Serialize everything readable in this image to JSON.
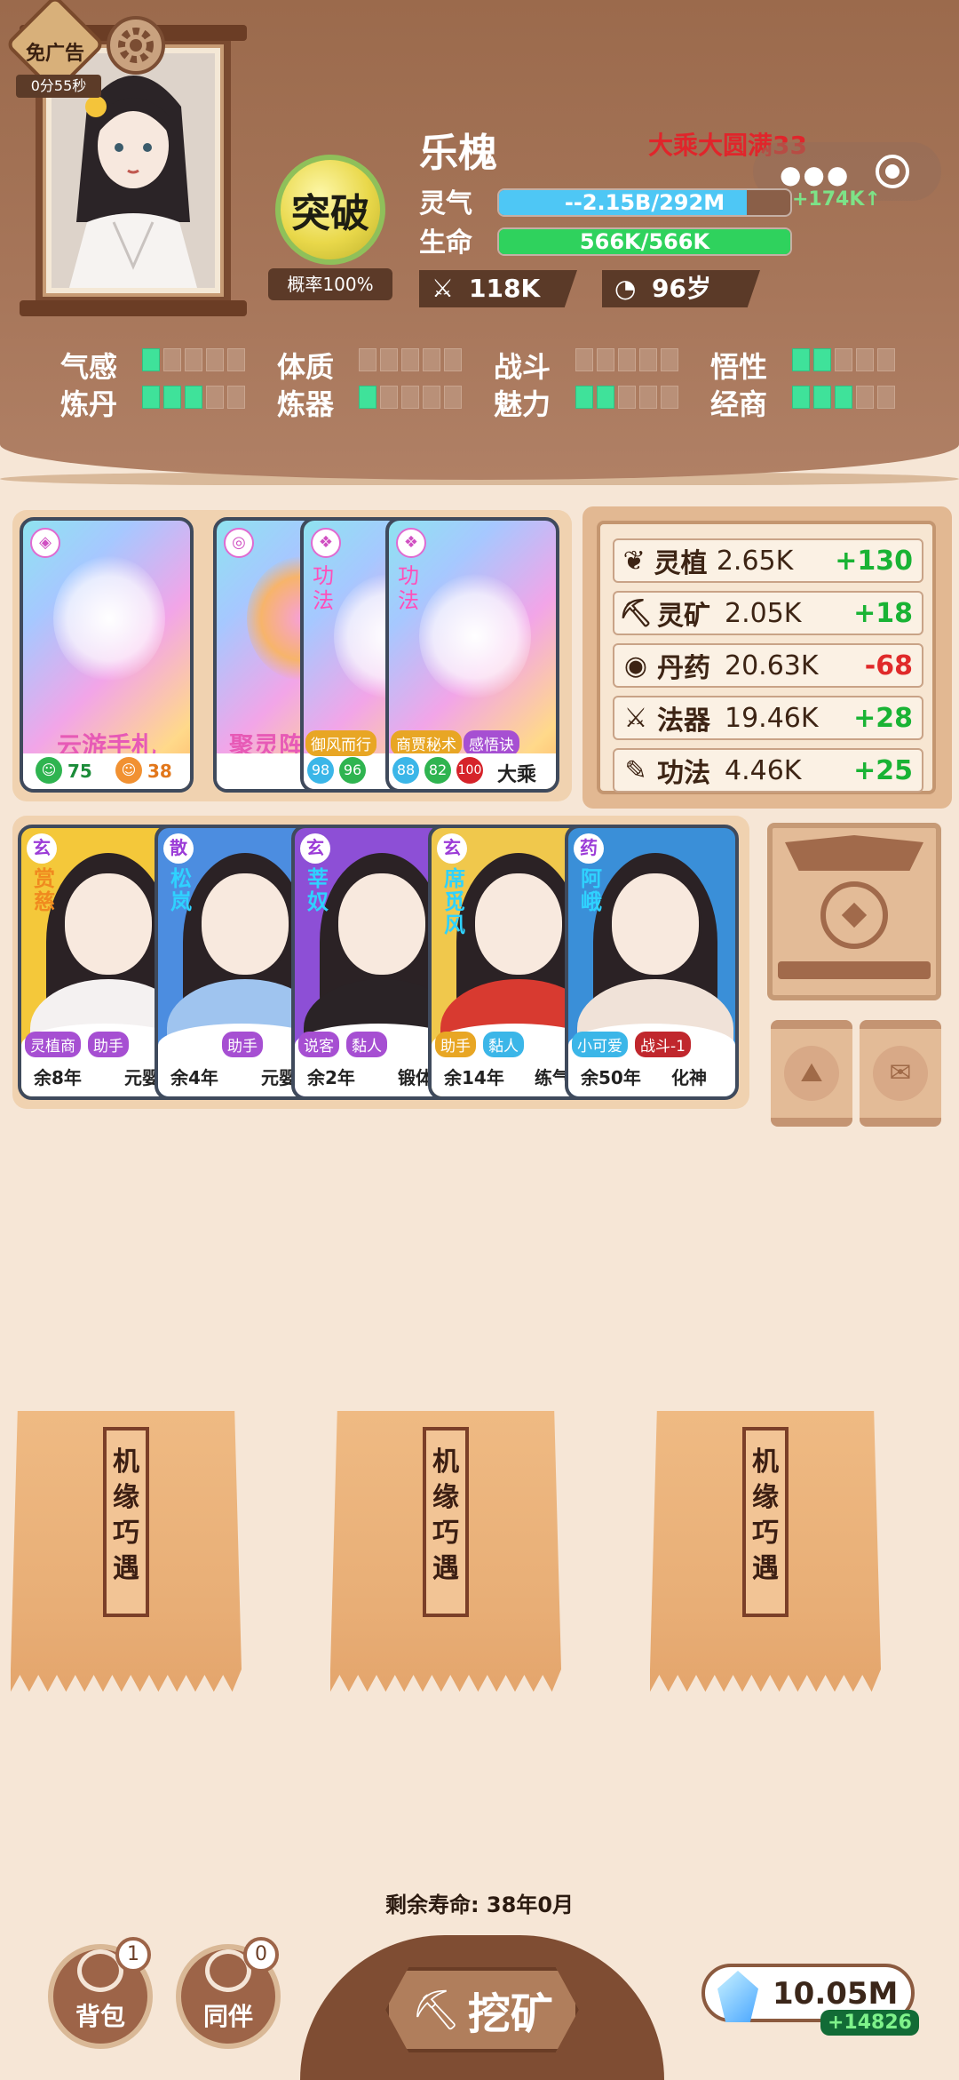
{
  "header": {
    "no_ad_label": "免广告",
    "no_ad_timer": "0分55秒",
    "character_name": "乐槐",
    "realm": "大乘大圆满33",
    "breakthrough_label": "突破",
    "breakthrough_chance": "概率100%",
    "qi_label": "灵气",
    "qi_value": "--2.15B/292M",
    "qi_fill": 0.85,
    "qi_gain": "+174K↑",
    "life_label": "生命",
    "life_value": "566K/566K",
    "life_fill": 1.0,
    "power": "118K",
    "age": "96岁",
    "attributes": [
      {
        "label": "气感",
        "level": 1
      },
      {
        "label": "体质",
        "level": 0
      },
      {
        "label": "战斗",
        "level": 0
      },
      {
        "label": "悟性",
        "level": 2
      },
      {
        "label": "炼丹",
        "level": 3
      },
      {
        "label": "炼器",
        "level": 1
      },
      {
        "label": "魅力",
        "level": 2
      },
      {
        "label": "经商",
        "level": 3
      }
    ]
  },
  "cards": [
    {
      "name": "云游手札",
      "stat1": "75",
      "stat2": "38"
    },
    {
      "name": "聚灵阵"
    },
    {
      "type": "功法",
      "tag": "御风而行",
      "n1": "98",
      "n2": "96"
    },
    {
      "type": "功法",
      "tag1": "商贾秘术",
      "tag2": "感悟诀",
      "n1": "88",
      "n2": "82",
      "n3": "100",
      "realm": "大乘"
    }
  ],
  "resources": [
    {
      "icon": "sprout-icon",
      "label": "灵植",
      "value": "2.65K",
      "delta": "+130"
    },
    {
      "icon": "pickaxe-icon",
      "label": "灵矿",
      "value": "2.05K",
      "delta": "+18"
    },
    {
      "icon": "pill-icon",
      "label": "丹药",
      "value": "20.63K",
      "delta": "-68"
    },
    {
      "icon": "swords-icon",
      "label": "法器",
      "value": "19.46K",
      "delta": "+28"
    },
    {
      "icon": "scroll-icon",
      "label": "功法",
      "value": "4.46K",
      "delta": "+25"
    }
  ],
  "companions": [
    {
      "sect": "玄",
      "name": "赏慈",
      "tag1": "灵植商",
      "tag2": "助手",
      "life": "余8年",
      "job": "元婴",
      "bg": "#f4c83a",
      "robe": "#f4f1f1"
    },
    {
      "sect": "散",
      "name": "松岚",
      "tag1": "",
      "tag2": "助手",
      "life": "余4年",
      "job": "元婴",
      "bg": "#4c8de0",
      "robe": "#9fc4ef"
    },
    {
      "sect": "玄",
      "name": "莘奴",
      "tag1": "说客",
      "tag2": "黏人",
      "life": "余2年",
      "job": "锻体",
      "bg": "#8d4fd6",
      "robe": "#2a2326"
    },
    {
      "sect": "玄",
      "name": "席觅风",
      "tag1": "助手",
      "tag2": "黏人",
      "life": "余14年",
      "job": "练气",
      "bg": "#f0c84c",
      "robe": "#d83a30"
    },
    {
      "sect": "药",
      "name": "阿峨",
      "tag1": "小可爱",
      "tag2": "战斗-1",
      "life": "余50年",
      "job": "化神",
      "bg": "#3a8fd8",
      "robe": "#f0e2d8"
    }
  ],
  "fortune_bag_text": [
    "机",
    "缘",
    "巧",
    "遇"
  ],
  "lifespan": "剩余寿命: 38年0月",
  "bottom": {
    "bag_label": "背包",
    "bag_count": "1",
    "companion_label": "同伴",
    "companion_count": "0",
    "mine_label": "挖矿",
    "crystals": "10.05M",
    "crystal_gain": "+14826"
  },
  "colors": {
    "qi": "#4ec7f5",
    "life": "#2fd25d",
    "pip_on": "#3fe29a",
    "positive": "#19b334",
    "negative": "#e02a2a"
  }
}
